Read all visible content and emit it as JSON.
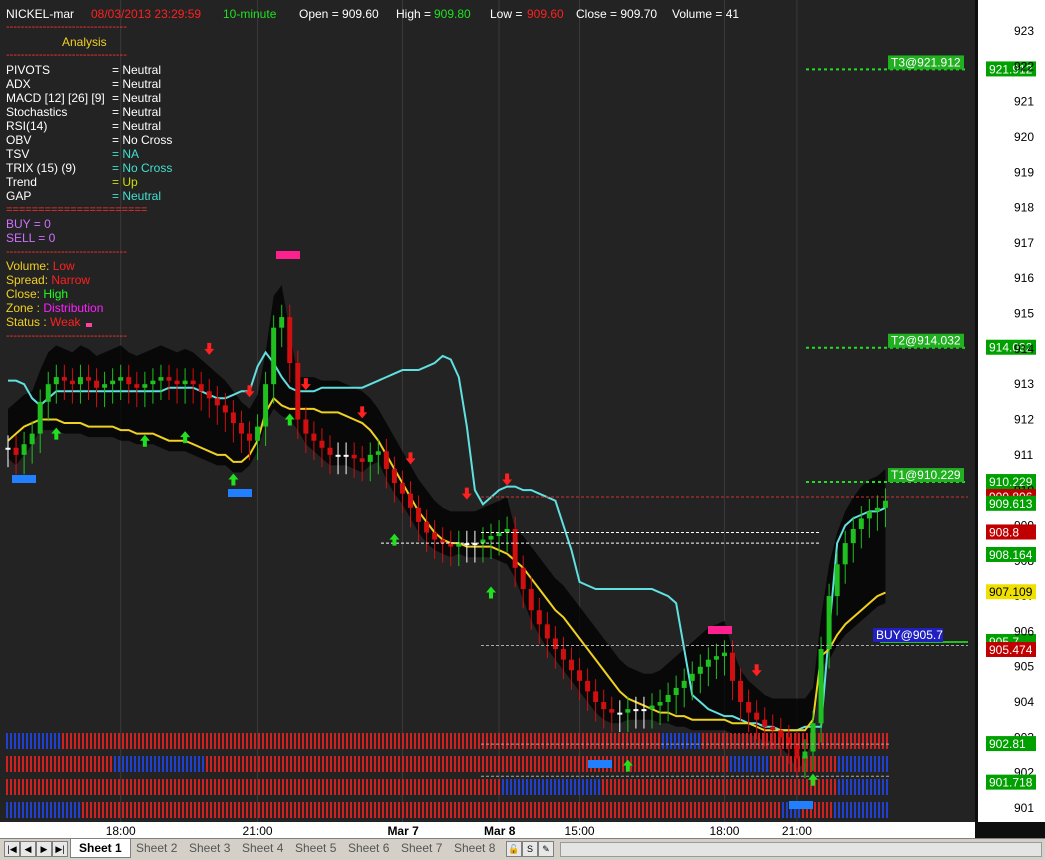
{
  "header": {
    "symbol": "NICKEL-mar",
    "datetime": "08/03/2013 23:29:59",
    "interval": "10-minute",
    "open": "Open = 909.60",
    "high_label": "High = ",
    "high_value": "909.80",
    "low_label": "Low = ",
    "low_value": "909.60",
    "close": "Close = 909.70",
    "volume": "Volume = 41"
  },
  "panel": {
    "dashes": "---------------------------------",
    "title": "Analysis",
    "rows": [
      {
        "label": "PIVOTS",
        "value": "= Neutral",
        "color": "#ffffff"
      },
      {
        "label": "ADX",
        "value": "= Neutral",
        "color": "#ffffff"
      },
      {
        "label": "MACD [12] [26] [9]",
        "value": "= Neutral",
        "color": "#ffffff"
      },
      {
        "label": "Stochastics",
        "value": "= Neutral",
        "color": "#ffffff"
      },
      {
        "label": "RSI(14)",
        "value": "= Neutral",
        "color": "#ffffff"
      },
      {
        "label": "OBV",
        "value": "= No Cross",
        "color": "#ffffff"
      },
      {
        "label": "TSV",
        "value": "= NA",
        "color": "#40e0d0"
      },
      {
        "label": "TRIX (15) (9)",
        "value": "= No Cross",
        "color": "#40e0d0"
      },
      {
        "label": "Trend",
        "value": "= Up",
        "color": "#c8e000"
      },
      {
        "label": "GAP",
        "value": "= Neutral",
        "color": "#40e0d0"
      }
    ],
    "equals": "======================",
    "buy": "BUY   =    0",
    "sell": "SELL   =    0",
    "status": [
      {
        "label": "Volume: ",
        "value": "Low",
        "color": "#ff2020"
      },
      {
        "label": "Spread: ",
        "value": "Narrow",
        "color": "#ff2020"
      },
      {
        "label": "Close: ",
        "value": "High",
        "color": "#20ff20"
      },
      {
        "label": "Zone : ",
        "value": "Distribution",
        "color": "#ff20ff"
      },
      {
        "label": "Status : ",
        "value": "Weak",
        "color": "#ff2020"
      }
    ]
  },
  "chart_data": {
    "type": "candlestick",
    "ylim": [
      900.5,
      923.5
    ],
    "y_ticks": [
      923,
      922,
      921,
      920,
      919,
      918,
      917,
      916,
      915,
      914,
      913,
      912,
      911,
      910,
      909,
      908,
      907,
      906,
      905,
      904,
      903,
      902,
      901
    ],
    "x_tick_labels": [
      "18:00",
      "21:00",
      "Mar 7",
      "Mar 8",
      "15:00",
      "18:00",
      "21:00"
    ],
    "x_tick_index": [
      14,
      31,
      49,
      61,
      71,
      89,
      98
    ],
    "candles_close": [
      911.2,
      911.0,
      911.3,
      911.6,
      912.5,
      913.0,
      913.2,
      913.1,
      913.0,
      913.2,
      913.1,
      912.9,
      913.0,
      913.1,
      913.2,
      913.0,
      912.9,
      913.0,
      913.1,
      913.2,
      913.1,
      913.0,
      913.1,
      913.0,
      912.8,
      912.6,
      912.4,
      912.2,
      911.9,
      911.6,
      911.4,
      911.8,
      913.0,
      914.6,
      914.9,
      913.6,
      912.0,
      911.6,
      911.4,
      911.2,
      911.0,
      911.0,
      911.0,
      910.9,
      910.8,
      911.0,
      911.1,
      910.6,
      910.2,
      909.9,
      909.5,
      909.1,
      908.8,
      908.6,
      908.5,
      908.4,
      908.5,
      908.5,
      908.5,
      908.6,
      908.7,
      908.8,
      908.9,
      907.8,
      907.2,
      906.6,
      906.2,
      905.8,
      905.5,
      905.2,
      904.9,
      904.6,
      904.3,
      904.0,
      903.8,
      903.7,
      903.7,
      903.8,
      903.8,
      903.8,
      903.9,
      904.0,
      904.2,
      904.4,
      904.6,
      904.8,
      905.0,
      905.2,
      905.3,
      905.4,
      904.6,
      904.0,
      903.7,
      903.5,
      903.3,
      903.2,
      903.0,
      902.8,
      902.4,
      902.6,
      903.4,
      905.5,
      907.0,
      907.9,
      908.5,
      908.9,
      909.2,
      909.4,
      909.5,
      909.7
    ],
    "series": [
      {
        "name": "cyan",
        "values": [
          913.1,
          913.1,
          913.0,
          912.6,
          912.4,
          912.6,
          912.8,
          912.8,
          912.8,
          912.8,
          912.8,
          912.8,
          912.8,
          912.8,
          912.8,
          912.8,
          912.8,
          912.8,
          912.8,
          912.8,
          912.9,
          912.9,
          912.9,
          912.9,
          912.8,
          912.7,
          912.6,
          912.6,
          912.7,
          912.8,
          912.8,
          913.5,
          913.9,
          913.6,
          913.2,
          912.9,
          912.8,
          912.8,
          912.8,
          912.9,
          912.9,
          912.9,
          912.9,
          912.9,
          912.9,
          913.0,
          913.1,
          913.2,
          913.3,
          913.4,
          913.4,
          913.4,
          913.5,
          913.6,
          913.8,
          913.7,
          913.2,
          911.8,
          910.0,
          909.6,
          909.8,
          910.0,
          910.1,
          910.1,
          910.0,
          910.0,
          909.9,
          909.8,
          909.7,
          909.0,
          908.3,
          907.4,
          907.3,
          907.2,
          907.2,
          907.2,
          907.2,
          907.2,
          907.2,
          907.2,
          907.2,
          907.1,
          907.0,
          906.8,
          905.5,
          904.2,
          904.0,
          903.8,
          903.7,
          903.6,
          903.6,
          903.5,
          903.4,
          903.4,
          903.3,
          903.3,
          903.2,
          903.2,
          903.2,
          903.3,
          903.3,
          903.3,
          906.0,
          908.5,
          909.0,
          909.2,
          909.3,
          909.4,
          909.4,
          909.5
        ]
      },
      {
        "name": "yellow",
        "values": [
          911.4,
          911.6,
          911.8,
          911.9,
          912.0,
          912.0,
          912.0,
          911.9,
          911.9,
          911.9,
          911.8,
          911.8,
          911.8,
          911.8,
          911.7,
          911.7,
          911.6,
          911.6,
          911.6,
          911.5,
          911.4,
          911.4,
          911.4,
          911.3,
          911.2,
          911.1,
          911.0,
          911.0,
          910.8,
          910.8,
          911.0,
          911.4,
          912.2,
          912.6,
          912.4,
          912.3,
          912.3,
          912.3,
          912.3,
          912.2,
          912.2,
          912.2,
          912.1,
          912.0,
          911.9,
          911.7,
          911.4,
          911.0,
          910.6,
          910.2,
          909.8,
          909.4,
          909.1,
          908.8,
          908.6,
          908.5,
          908.5,
          908.4,
          908.4,
          908.4,
          908.4,
          908.3,
          908.2,
          908.0,
          907.8,
          907.5,
          907.2,
          906.9,
          906.6,
          906.4,
          906.1,
          905.8,
          905.5,
          905.2,
          904.9,
          904.6,
          904.3,
          904.1,
          904.0,
          903.9,
          903.8,
          903.7,
          903.7,
          903.6,
          903.6,
          903.5,
          903.5,
          903.5,
          903.5,
          903.5,
          903.4,
          903.4,
          903.4,
          903.3,
          903.2,
          903.2,
          903.2,
          903.2,
          903.2,
          903.2,
          903.5,
          905.3,
          905.5,
          905.9,
          906.2,
          906.4,
          906.6,
          906.8,
          907.0,
          907.1
        ]
      }
    ],
    "levels": [
      {
        "label": "T3@921.912",
        "value": 921.912,
        "price_tag": "921.912"
      },
      {
        "label": "T2@914.032",
        "value": 914.032,
        "price_tag": "914.032"
      },
      {
        "label": "T1@910.229",
        "value": 910.229,
        "price_tag": "910.229"
      },
      {
        "label": "BUY@905.7",
        "value": 905.7,
        "price_tag": "905.7"
      }
    ],
    "price_tags": [
      {
        "text": "909.806",
        "value": 909.806,
        "bg": "#c00000"
      },
      {
        "text": "909.613",
        "value": 909.613,
        "bg": "#00a000"
      },
      {
        "text": "908.802",
        "value": 908.802,
        "bg": "#c00000"
      },
      {
        "text": "908.8",
        "value": 908.8,
        "bg": "#c00000"
      },
      {
        "text": "908.164",
        "value": 908.164,
        "bg": "#00a000"
      },
      {
        "text": "907.109",
        "value": 907.109,
        "bg": "#f0e000"
      },
      {
        "text": "905.474",
        "value": 905.474,
        "bg": "#c00000"
      },
      {
        "text": "902.81",
        "value": 902.81,
        "bg": "#00a000"
      },
      {
        "text": "901.718",
        "value": 901.718,
        "bg": "#00a000"
      }
    ],
    "up_arrows_index": [
      6,
      17,
      22,
      28,
      35,
      48,
      60,
      77,
      100
    ],
    "down_arrows_index": [
      25,
      30,
      37,
      44,
      50,
      57,
      62,
      93
    ]
  },
  "colors": {
    "bull": "#20c020",
    "bear": "#d01010",
    "cyan": "#60e0e0",
    "yellow": "#f0d020",
    "band": "#000000",
    "bg": "#1e1e1e",
    "axis_bg": "#ffffff",
    "grid": "#444444",
    "dashes": "#ff3030",
    "title": "#f0d020"
  },
  "tabs": [
    "Sheet 1",
    "Sheet 2",
    "Sheet 3",
    "Sheet 4",
    "Sheet 5",
    "Sheet 6",
    "Sheet 7",
    "Sheet 8"
  ],
  "icons": [
    "first-icon",
    "prev-icon",
    "next-icon",
    "last-icon",
    "lock-icon",
    "s-icon",
    "pen-icon"
  ]
}
